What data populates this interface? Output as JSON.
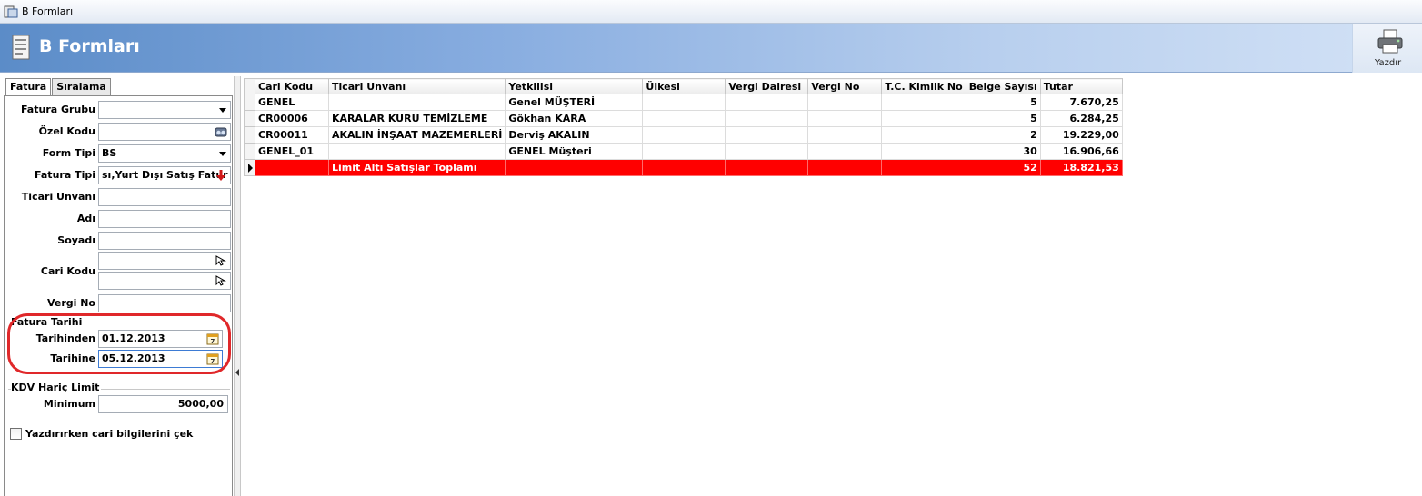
{
  "window": {
    "title": "B Formları"
  },
  "banner": {
    "title": "B Formları",
    "print_label": "Yazdır"
  },
  "tabs": [
    {
      "label": "Fatura"
    },
    {
      "label": "Sıralama"
    }
  ],
  "filters": {
    "fatura_grubu": {
      "label": "Fatura Grubu",
      "value": ""
    },
    "ozel_kodu": {
      "label": "Özel Kodu",
      "value": ""
    },
    "form_tipi": {
      "label": "Form Tipi",
      "value": "BS"
    },
    "fatura_tipi": {
      "label": "Fatura Tipi",
      "value": "sı,Yurt Dışı Satış Fatur"
    },
    "ticari_unvani": {
      "label": "Ticari Unvanı",
      "value": ""
    },
    "adi": {
      "label": "Adı",
      "value": ""
    },
    "soyadi": {
      "label": "Soyadı",
      "value": ""
    },
    "cari_kodu": {
      "label": "Cari Kodu",
      "value1": "",
      "value2": ""
    },
    "vergi_no": {
      "label": "Vergi No",
      "value": ""
    }
  },
  "fatura_tarihi": {
    "title": "Fatura Tarihi",
    "tarihinden_label": "Tarihinden",
    "tarihinden": "01.12.2013",
    "tarihine_label": "Tarihine",
    "tarihine": "05.12.2013"
  },
  "kdv_limit": {
    "title": "KDV Hariç Limit",
    "minimum_label": "Minimum",
    "minimum": "5000,00"
  },
  "print_option": {
    "label": "Yazdırırken cari bilgilerini çek",
    "checked": false
  },
  "grid": {
    "columns": [
      "Cari Kodu",
      "Ticari Unvanı",
      "Yetkilisi",
      "Ülkesi",
      "Vergi Dairesi",
      "Vergi No",
      "T.C. Kimlik No",
      "Belge Sayısı",
      "Tutar"
    ],
    "rows": [
      [
        "GENEL",
        "",
        "Genel MÜŞTERİ",
        "",
        "",
        "",
        "",
        "5",
        "7.670,25"
      ],
      [
        "CR00006",
        "KARALAR KURU TEMİZLEME",
        "Gökhan KARA",
        "",
        "",
        "",
        "",
        "5",
        "6.284,25"
      ],
      [
        "CR00011",
        "AKALIN İNŞAAT MAZEMERLERİ",
        "Derviş AKALIN",
        "",
        "",
        "",
        "",
        "2",
        "19.229,00"
      ],
      [
        "GENEL_01",
        "",
        "GENEL Müşteri",
        "",
        "",
        "",
        "",
        "30",
        "16.906,66"
      ]
    ],
    "total_row": [
      "",
      "Limit Altı Satışlar Toplamı",
      "",
      "",
      "",
      "",
      "",
      "52",
      "18.821,53"
    ]
  },
  "colors": {
    "highlight": "#e0282a",
    "total_row": "#ff0000",
    "banner_start": "#5b8cc8"
  }
}
